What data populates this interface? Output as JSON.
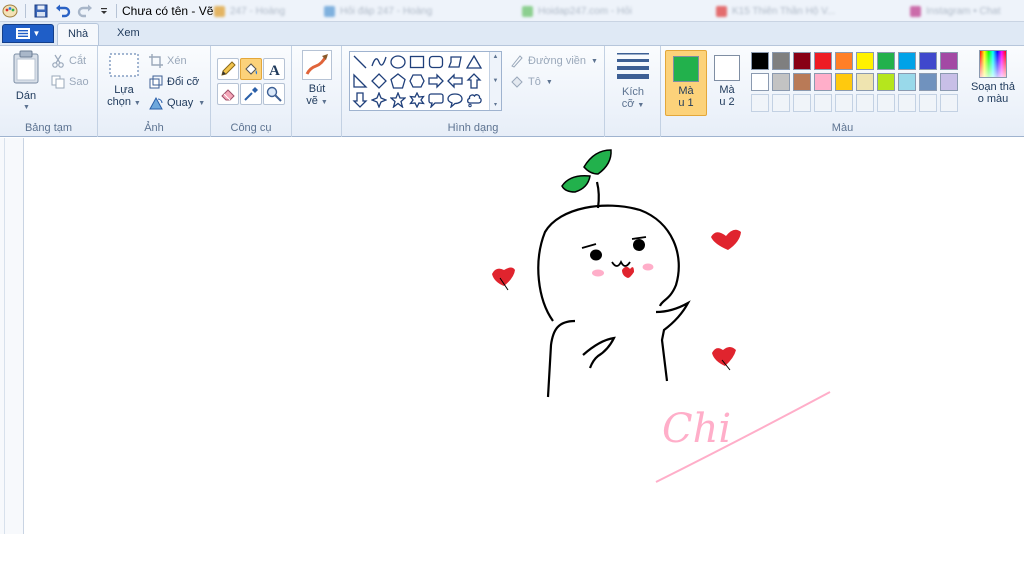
{
  "window": {
    "title": "Chưa có tên - Vẽ"
  },
  "background_tabs": [
    {
      "label": "247 - Hoàng",
      "color": "#e0a030"
    },
    {
      "label": "Hỏi đáp 247 - Hoàng",
      "color": "#5b9bd5"
    },
    {
      "label": "Hoidap247.com - Hỏi",
      "color": "#6cc46c"
    },
    {
      "label": "K15 Thiên Thần Hộ V...",
      "color": "#e04040"
    },
    {
      "label": "Instagram • Chat",
      "color": "#c04090"
    }
  ],
  "tabs": [
    {
      "label": "Nhà",
      "active": true
    },
    {
      "label": "Xem",
      "active": false
    }
  ],
  "groups": {
    "clipboard": {
      "label": "Bảng tạm",
      "paste": "Dán",
      "cut": "Cắt",
      "copy": "Sao"
    },
    "image": {
      "label": "Ảnh",
      "select_line1": "Lựa",
      "select_line2": "chọn",
      "crop": "Xén",
      "resize": "Đổi cỡ",
      "rotate": "Quay"
    },
    "tools": {
      "label": "Công cụ"
    },
    "brushes": {
      "line1": "Bút",
      "line2": "vẽ"
    },
    "shapes": {
      "label": "Hình dạng",
      "outline": "Đường viền",
      "fill": "Tô"
    },
    "size": {
      "line1": "Kích",
      "line2": "cỡ"
    },
    "colors": {
      "label": "Màu",
      "color1_line1": "Mà",
      "color1_line2": "u 1",
      "color2_line1": "Mà",
      "color2_line2": "u 2",
      "edit_line1": "Soạn thả",
      "edit_line2": "o màu",
      "color1": "#22b14c",
      "color2": "#ffffff",
      "palette_row1": [
        "#000000",
        "#7f7f7f",
        "#880015",
        "#ed1c24",
        "#ff7f27",
        "#fff200",
        "#22b14c",
        "#00a2e8",
        "#3f48cc",
        "#a349a4"
      ],
      "palette_row2": [
        "#ffffff",
        "#c3c3c3",
        "#b97a57",
        "#ffaec9",
        "#ffc90e",
        "#efe4b0",
        "#b5e61d",
        "#99d9ea",
        "#7092be",
        "#c8bfe7"
      ]
    }
  },
  "canvas": {
    "signature": "Chi"
  }
}
